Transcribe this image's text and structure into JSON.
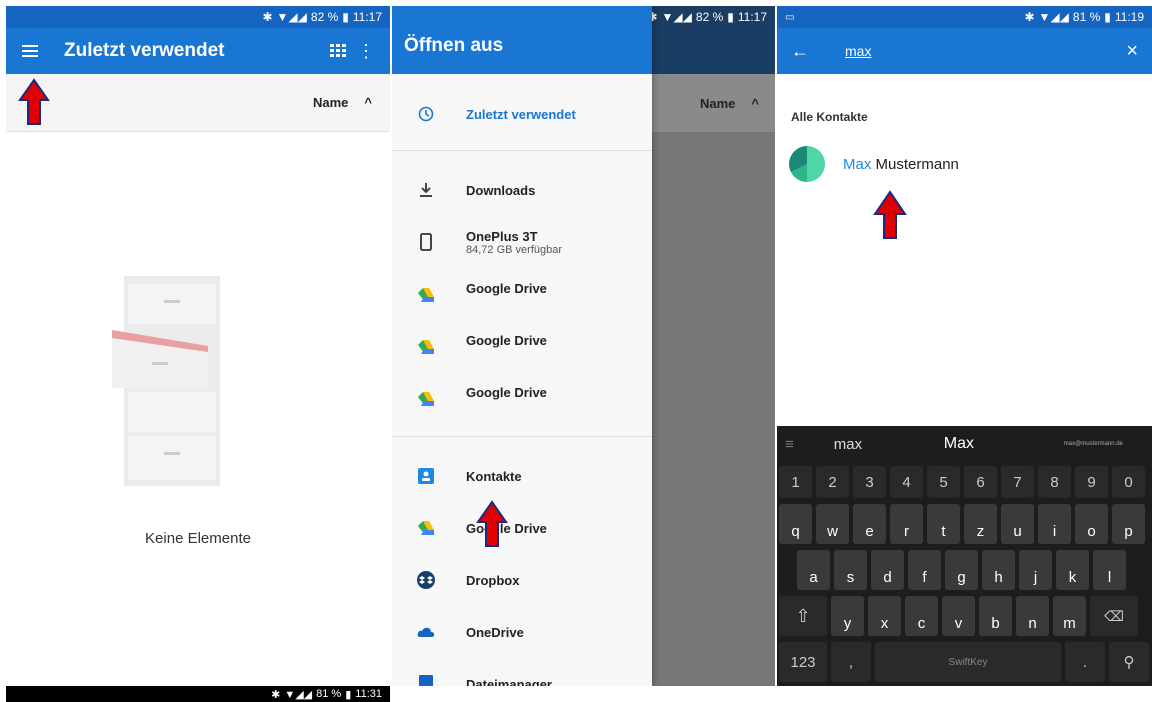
{
  "panel1": {
    "status": {
      "time": "11:17",
      "battery": "82 %"
    },
    "title": "Zuletzt verwendet",
    "sort_label": "Name",
    "empty_text": "Keine Elemente",
    "bottom_status": {
      "time": "11:31",
      "battery": "81 %"
    }
  },
  "panel2": {
    "status": {
      "time": "11:17",
      "battery": "82 %"
    },
    "title": "Öffnen aus",
    "sort_label": "Name",
    "items": [
      {
        "label": "Zuletzt verwendet",
        "icon": "clock-icon"
      },
      {
        "label": "Downloads",
        "icon": "download-icon"
      },
      {
        "label": "OnePlus 3T",
        "sub": "84,72 GB verfügbar",
        "icon": "phone-icon"
      },
      {
        "label": "Google Drive",
        "icon": "google-drive-icon"
      },
      {
        "label": "Google Drive",
        "icon": "google-drive-icon"
      },
      {
        "label": "Google Drive",
        "icon": "google-drive-icon"
      },
      {
        "label": "Kontakte",
        "icon": "contacts-icon"
      },
      {
        "label": "Google Drive",
        "icon": "google-drive-icon"
      },
      {
        "label": "Dropbox",
        "icon": "dropbox-icon"
      },
      {
        "label": "OneDrive",
        "icon": "onedrive-icon"
      },
      {
        "label": "Dateimanager",
        "icon": "file-manager-icon"
      }
    ]
  },
  "panel3": {
    "status": {
      "time": "11:19",
      "battery": "81 %"
    },
    "query": "max",
    "section": "Alle Kontakte",
    "contact": {
      "highlight": "Max",
      "rest": " Mustermann"
    },
    "keyboard": {
      "suggestions": [
        "max",
        "Max",
        "max@mustermann.de"
      ],
      "numbers": [
        "1",
        "2",
        "3",
        "4",
        "5",
        "6",
        "7",
        "8",
        "9",
        "0"
      ],
      "row1": [
        "q",
        "w",
        "e",
        "r",
        "t",
        "z",
        "u",
        "i",
        "o",
        "p"
      ],
      "row2": [
        "a",
        "s",
        "d",
        "f",
        "g",
        "h",
        "j",
        "k",
        "l"
      ],
      "row3": [
        "y",
        "x",
        "c",
        "v",
        "b",
        "n",
        "m"
      ],
      "symbols_key": "123",
      "space_label": "SwiftKey"
    }
  },
  "colors": {
    "appbar": "#1976d2",
    "statusbar": "#1565c0",
    "arrow": "#e00000"
  }
}
